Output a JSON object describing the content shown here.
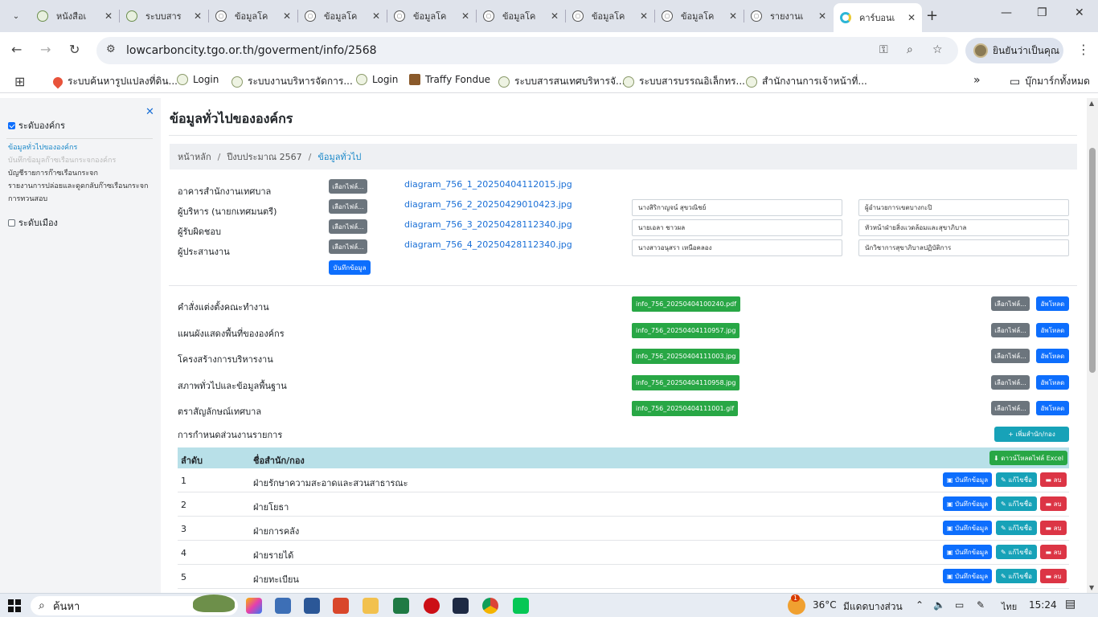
{
  "browser": {
    "tabs": [
      {
        "label": "หนังสือเ",
        "icon": "green"
      },
      {
        "label": "ระบบสาร",
        "icon": "green"
      },
      {
        "label": "ข้อมูลโค",
        "icon": "globe"
      },
      {
        "label": "ข้อมูลโค",
        "icon": "globe"
      },
      {
        "label": "ข้อมูลโค",
        "icon": "globe"
      },
      {
        "label": "ข้อมูลโค",
        "icon": "globe"
      },
      {
        "label": "ข้อมูลโค",
        "icon": "globe"
      },
      {
        "label": "ข้อมูลโค",
        "icon": "globe"
      },
      {
        "label": "รายงานเ",
        "icon": "globe"
      },
      {
        "label": "คาร์บอนเ",
        "icon": "c",
        "active": true
      }
    ],
    "url": "lowcarboncity.tgo.or.th/goverment/info/2568",
    "profile_label": "ยินยันว่าเป็นคุณ",
    "bookmarks": [
      "ระบบค้นหารูปแปลงที่ดิน...",
      "Login",
      "ระบบงานบริหารจัดการ...",
      "Login",
      "Traffy Fondue",
      "ระบบสารสนเทศบริหารจั...",
      "ระบบสารบรรณอิเล็กทร...",
      "สำนักงานการเจ้าหน้าที่..."
    ],
    "bookmarks_all": "บุ๊กมาร์กทั้งหมด"
  },
  "sidebar": {
    "org_level": "ระดับองค์กร",
    "links": [
      "ข้อมูลทั่วไปขององค์กร",
      "บันทึกข้อมูลก๊าซเรือนกระจกองค์กร",
      "บัญชีรายการก๊าซเรือนกระจก",
      "รายงานการปล่อยและดูดกลับก๊าซเรือนกระจก",
      "การทวนสอบ"
    ],
    "city_level": "ระดับเมือง"
  },
  "main": {
    "title": "ข้อมูลทั่วไปขององค์กร",
    "breadcrumb": [
      "หน้าหลัก",
      "ปีงบประมาณ 2567",
      "ข้อมูลทั่วไป"
    ],
    "choose_file": "เลือกไฟล์...",
    "save": "บันทึกข้อมูล",
    "upload": "อัพโหลด",
    "people": [
      {
        "label": "อาคารสำนักงานเทศบาล",
        "file": "diagram_756_1_20250404112015.jpg",
        "name": "",
        "position": ""
      },
      {
        "label": "ผู้บริหาร (นายกเทศมนตรี)",
        "file": "diagram_756_2_20250429010423.jpg",
        "name": "นางสิริกาญจน์ สุขวณิชย์",
        "position": "ผู้อำนวยการเขตบางกะปิ"
      },
      {
        "label": "ผู้รับผิดชอบ",
        "file": "diagram_756_3_20250428112340.jpg",
        "name": "นายเอลา ชาวผล",
        "position": "หัวหน้าฝ่ายสิ่งแวดล้อมและสุขาภิบาล"
      },
      {
        "label": "ผู้ประสานงาน",
        "file": "diagram_756_4_20250428112340.jpg",
        "name": "นางสาวอนุสรา เหนือคลอง",
        "position": "นักวิชาการสุขาภิบาลปฏิบัติการ"
      }
    ],
    "documents": [
      {
        "label": "คำสั่งแต่งตั้งคณะทำงาน",
        "file": "info_756_20250404100240.pdf"
      },
      {
        "label": "แผนผังแสดงพื้นที่ขององค์กร",
        "file": "info_756_20250404110957.jpg"
      },
      {
        "label": "โครงสร้างการบริหารงาน",
        "file": "info_756_20250404111003.jpg"
      },
      {
        "label": "สภาพทั่วไปและข้อมูลพื้นฐาน",
        "file": "info_756_20250404110958.jpg"
      },
      {
        "label": "ตราสัญลักษณ์เทศบาล",
        "file": "info_756_20250404111001.gif"
      }
    ],
    "divisions_label": "การกำหนดส่วนงานรายการ",
    "add_division": "+ เพิ่มสำนัก/กอง",
    "download_excel": "⬇ ดาวน์โหลดไฟล์ Excel",
    "table": {
      "headers": [
        "ลำดับ",
        "ชื่อสำนัก/กอง"
      ],
      "rows": [
        {
          "no": "1",
          "name": "ฝ่ายรักษาความสะอาดและสวนสาธารณะ"
        },
        {
          "no": "2",
          "name": "ฝ่ายโยธา"
        },
        {
          "no": "3",
          "name": "ฝ่ายการคลัง"
        },
        {
          "no": "4",
          "name": "ฝ่ายรายได้"
        },
        {
          "no": "5",
          "name": "ฝ่ายทะเบียน"
        }
      ],
      "row_actions": {
        "save": "บันทึกข้อมูล",
        "edit": "แก้ไขชื่อ",
        "delete": "ลบ"
      }
    }
  },
  "taskbar": {
    "search": "ค้นหา",
    "weather_temp": "36°C",
    "weather_text": "มีแดดบางส่วน",
    "weather_badge": "1",
    "language": "ไทย",
    "time": "15:24"
  },
  "colors": {
    "primary": "#0d6efd",
    "success": "#28a745",
    "secondary": "#6c757d",
    "info": "#17a2b8",
    "danger": "#dc3545",
    "table_header": "#b8e0e8",
    "breadcrumb_active": "#1a88c9"
  }
}
